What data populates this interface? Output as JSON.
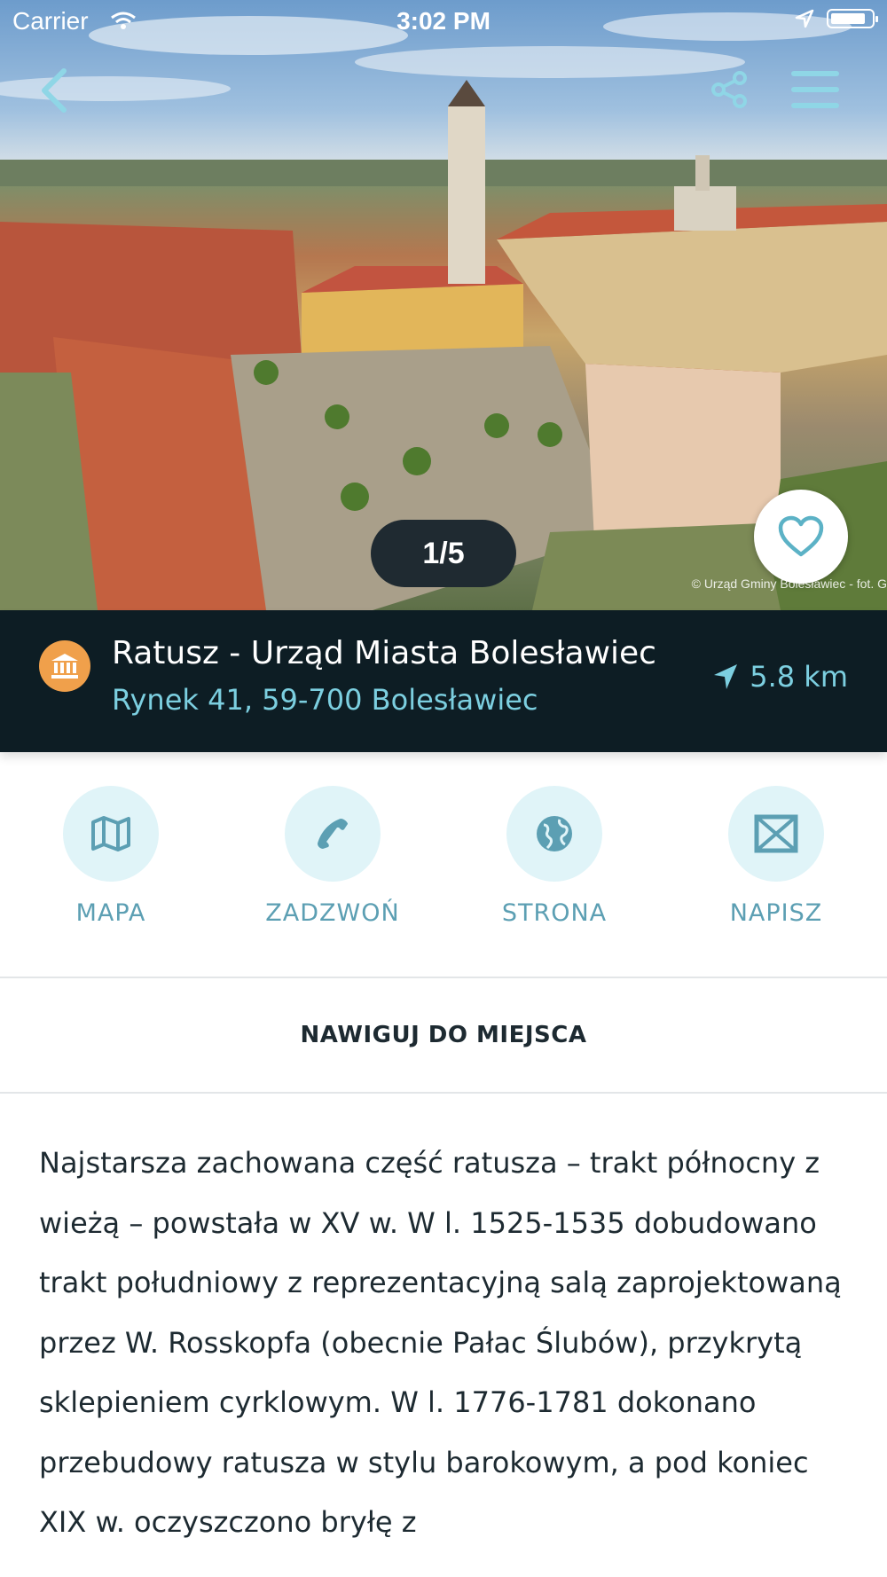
{
  "status_bar": {
    "carrier": "Carrier",
    "time": "3:02 PM"
  },
  "gallery": {
    "pager": "1/5",
    "credit": "© Urząd Gminy Bolesławiec - fot. G"
  },
  "place": {
    "name": "Ratusz - Urząd Miasta Bolesławiec",
    "address": "Rynek 41, 59-700 Bolesławiec",
    "distance": "5.8 km",
    "category_icon": "museum-icon",
    "category_color": "#f0a04b"
  },
  "actions": [
    {
      "label": "MAPA",
      "icon": "map-icon"
    },
    {
      "label": "ZADZWOŃ",
      "icon": "phone-icon"
    },
    {
      "label": "STRONA",
      "icon": "globe-icon"
    },
    {
      "label": "NAPISZ",
      "icon": "mail-icon"
    }
  ],
  "navigate_label": "NAWIGUJ DO MIEJSCA",
  "description": "Najstarsza zachowana część ratusza – trakt północny z wieżą – powstała w XV w. W l. 1525-1535 dobudowano trakt południowy z reprezentacyjną salą zaprojektowaną przez W. Rosskopfa (obecnie Pałac Ślubów), przykrytą sklepieniem cyrklowym. W l. 1776-1781 dokonano przebudowy ratusza w stylu barokowym, a pod koniec XIX w. oczyszczono bryłę z",
  "colors": {
    "info_bar_bg": "#0d1d24",
    "accent": "#7ccfe0",
    "action_circle": "#e0f4f8",
    "action_icon": "#5c9fb3"
  }
}
